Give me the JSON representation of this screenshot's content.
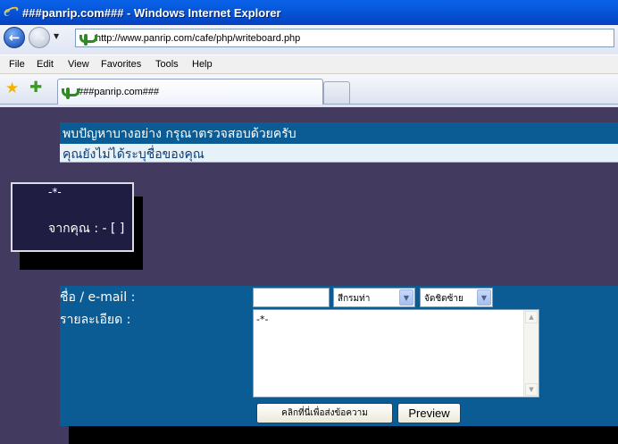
{
  "window": {
    "title": "###panrip.com### - Windows Internet Explorer",
    "url": "http://www.panrip.com/cafe/php/writeboard.php",
    "tab_title": "###panrip.com###"
  },
  "menu": [
    "File",
    "Edit",
    "View",
    "Favorites",
    "Tools",
    "Help"
  ],
  "alert": {
    "title": "พบปัญหาบางอย่าง กรุณาตรวจสอบด้วยครับ",
    "message": "คุณยังไม่ได้ระบุชื่อของคุณ"
  },
  "preview": {
    "message": "-*-",
    "from": "จากคุณ : - [ ]"
  },
  "form": {
    "name_label": "ชื่อ / e-mail :",
    "name_value": "",
    "color_select": "สีกรมท่า",
    "align_select": "จัดชิดซ้าย",
    "detail_label": "รายละเอียด :",
    "detail_value": "-*-",
    "submit_label": "คลิกที่นี่เพื่อส่งข้อความ",
    "preview_label": "Preview"
  },
  "colors": {
    "page_bg": "#433a60",
    "panel_bg": "#0b5c95",
    "alert_msg_bg": "#e6f1f8"
  }
}
